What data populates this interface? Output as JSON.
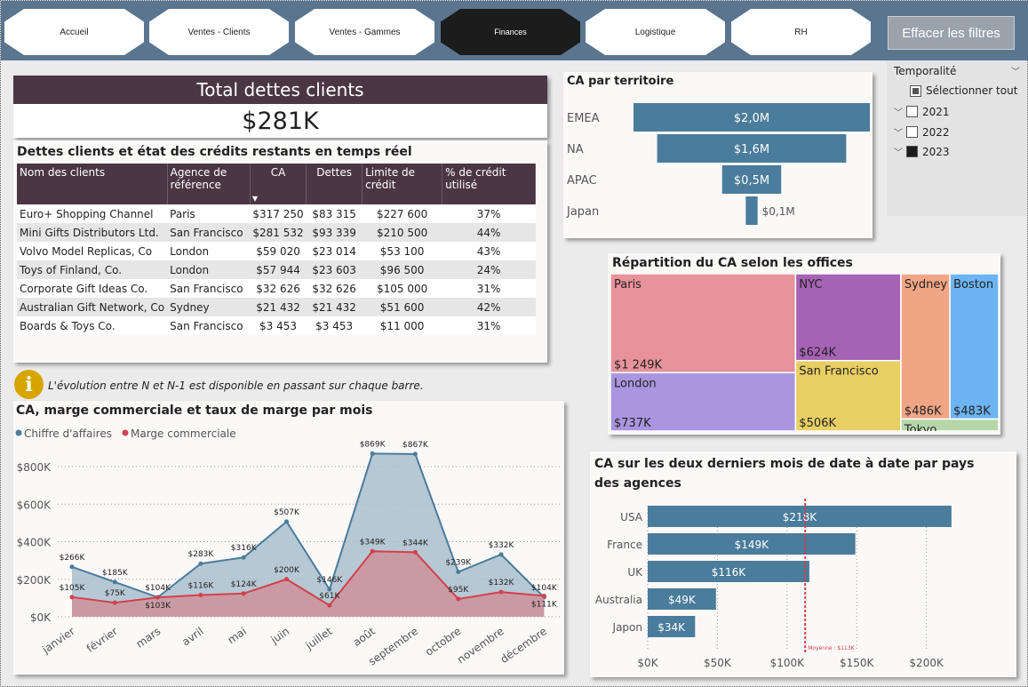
{
  "nav": {
    "items": [
      {
        "label": "Accueil"
      },
      {
        "label": "Ventes - Clients"
      },
      {
        "label": "Ventes - Gammes"
      },
      {
        "label": "Finances"
      },
      {
        "label": "Logistique"
      },
      {
        "label": "RH"
      }
    ],
    "active_index": 3,
    "clear_filters": "Effacer les filtres"
  },
  "kpi": {
    "title": "Total dettes clients",
    "value": "$281K"
  },
  "debts_table": {
    "title": "Dettes clients et état des crédits restants en temps réel",
    "columns": [
      "Nom des clients",
      "Agence de référence",
      "CA",
      "Dettes",
      "Limite de crédit",
      "% de crédit utilisé"
    ],
    "rows": [
      [
        "Euro+ Shopping Channel",
        "Paris",
        "$317 250",
        "$83 315",
        "$227 600",
        "37%"
      ],
      [
        "Mini Gifts Distributors Ltd.",
        "San Francisco",
        "$281 532",
        "$93 339",
        "$210 500",
        "44%"
      ],
      [
        "Volvo Model Replicas, Co",
        "London",
        "$59 020",
        "$23 014",
        "$53 100",
        "43%"
      ],
      [
        "Toys of Finland, Co.",
        "London",
        "$57 944",
        "$23 603",
        "$96 500",
        "24%"
      ],
      [
        "Corporate Gift Ideas Co.",
        "San Francisco",
        "$32 626",
        "$32 626",
        "$105 000",
        "31%"
      ],
      [
        "Australian Gift Network, Co",
        "Sydney",
        "$21 432",
        "$21 432",
        "$51 600",
        "42%"
      ],
      [
        "Boards & Toys Co.",
        "San Francisco",
        "$3 453",
        "$3 453",
        "$11 000",
        "31%"
      ]
    ]
  },
  "info": {
    "icon": "i",
    "text": "L'évolution entre N et N-1 est disponible en passant sur chaque barre."
  },
  "slicer": {
    "title": "Temporalité",
    "select_all": "Sélectionner tout",
    "options": [
      {
        "label": "2021",
        "checked": false
      },
      {
        "label": "2022",
        "checked": false
      },
      {
        "label": "2023",
        "checked": true
      }
    ]
  },
  "colors": {
    "accent_dark": "#4b3644",
    "bar_blue": "#4a7c9b",
    "marge_red": "#d1414d",
    "nav_bg": "#5a7590"
  },
  "chart_data": [
    {
      "id": "ca-territoire",
      "type": "bar",
      "orientation": "horizontal",
      "title": "CA par territoire",
      "categories": [
        "EMEA",
        "NA",
        "APAC",
        "Japan"
      ],
      "values": [
        2.0,
        1.6,
        0.5,
        0.1
      ],
      "labels": [
        "$2,0M",
        "$1,6M",
        "$0,5M",
        "$0,1M"
      ],
      "unit": "M$"
    },
    {
      "id": "offices-treemap",
      "type": "treemap",
      "title": "Répartition du CA selon les offices",
      "items": [
        {
          "name": "Paris",
          "label": "$1 249K",
          "value": 1249,
          "color": "#e8929a"
        },
        {
          "name": "NYC",
          "label": "$624K",
          "value": 624,
          "color": "#a662b4"
        },
        {
          "name": "Sydney",
          "label": "$486K",
          "value": 486,
          "color": "#f0a584"
        },
        {
          "name": "Boston",
          "label": "$483K",
          "value": 483,
          "color": "#6cb4f4"
        },
        {
          "name": "London",
          "label": "$737K",
          "value": 737,
          "color": "#a995e0"
        },
        {
          "name": "San Francisco",
          "label": "$506K",
          "value": 506,
          "color": "#e8cf63"
        },
        {
          "name": "Tokyo",
          "label": "",
          "value": 80,
          "color": "#b6d7a8"
        }
      ]
    },
    {
      "id": "ca-marge-mois",
      "type": "area",
      "title": "CA, marge commerciale et taux de marge par mois",
      "categories": [
        "janvier",
        "février",
        "mars",
        "avril",
        "mai",
        "juin",
        "juillet",
        "août",
        "septembre",
        "octobre",
        "novembre",
        "décembre"
      ],
      "series": [
        {
          "name": "Chiffre d'affaires",
          "values": [
            266,
            185,
            104,
            283,
            316,
            507,
            146,
            869,
            867,
            239,
            332,
            104
          ],
          "labels": [
            "$266K",
            "$185K",
            "$104K",
            "$283K",
            "$316K",
            "$507K",
            "$146K",
            "$869K",
            "$867K",
            "$239K",
            "$332K",
            "$104K"
          ],
          "color": "#4a7c9b"
        },
        {
          "name": "Marge commerciale",
          "values": [
            105,
            75,
            103,
            116,
            124,
            200,
            61,
            349,
            344,
            95,
            132,
            111
          ],
          "labels": [
            "$105K",
            "$75K",
            "$103K",
            "$116K",
            "$124K",
            "$200K",
            "$61K",
            "$349K",
            "$344K",
            "$95K",
            "$132K",
            "$111K"
          ],
          "color": "#d1414d"
        }
      ],
      "yticks": [
        "$0K",
        "$200K",
        "$400K",
        "$600K",
        "$800K"
      ],
      "ylim": [
        0,
        800
      ]
    },
    {
      "id": "ca-pays",
      "type": "bar",
      "orientation": "horizontal",
      "title": "CA sur les deux derniers mois de date à date par pays des agences",
      "categories": [
        "USA",
        "France",
        "UK",
        "Australia",
        "Japon"
      ],
      "values": [
        218,
        149,
        116,
        49,
        34
      ],
      "labels": [
        "$218K",
        "$149K",
        "$116K",
        "$49K",
        "$34K"
      ],
      "xticks": [
        "$0K",
        "$50K",
        "$100K",
        "$150K",
        "$200K"
      ],
      "xlim": [
        0,
        230
      ],
      "average": {
        "value": 113,
        "label": "Moyenne : $113K"
      }
    }
  ]
}
